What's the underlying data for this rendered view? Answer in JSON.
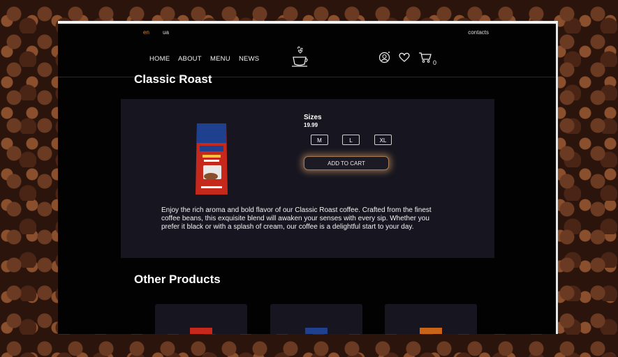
{
  "header": {
    "languages": [
      {
        "code": "en",
        "active": true
      },
      {
        "code": "ua",
        "active": false
      }
    ],
    "contacts_label": "contacts"
  },
  "nav": {
    "links": [
      "HOME",
      "ABOUT",
      "MENU",
      "NEWS"
    ],
    "logo_icon": "coffee-cup-logo-icon",
    "user_icon": "user-icon",
    "wishlist_icon": "heart-icon",
    "cart_icon": "cart-icon",
    "cart_count": "0"
  },
  "product": {
    "title": "Classic Roast",
    "sizes_label": "Sizes",
    "price": "19.99",
    "sizes": [
      "M",
      "L",
      "XL"
    ],
    "add_to_cart_label": "ADD TO CART",
    "description": "Enjoy the rich aroma and bold flavor of our Classic Roast coffee. Crafted from the finest coffee beans, this exquisite blend will awaken your senses with every sip. Whether you prefer it black or with a splash of cream, our coffee is a delightful start to your day.",
    "package_colors": {
      "bag": "#c7281c",
      "band": "#1f3f8f",
      "accent": "#f5c33b"
    }
  },
  "other_products": {
    "heading": "Other Products",
    "cards": [
      {
        "thumb_color": "#c7281c"
      },
      {
        "thumb_color": "#1f3f8f"
      },
      {
        "thumb_color": "#c8641a"
      }
    ]
  },
  "colors": {
    "accent": "#c98a3a",
    "card_bg": "#171620",
    "page_bg": "#020202"
  }
}
